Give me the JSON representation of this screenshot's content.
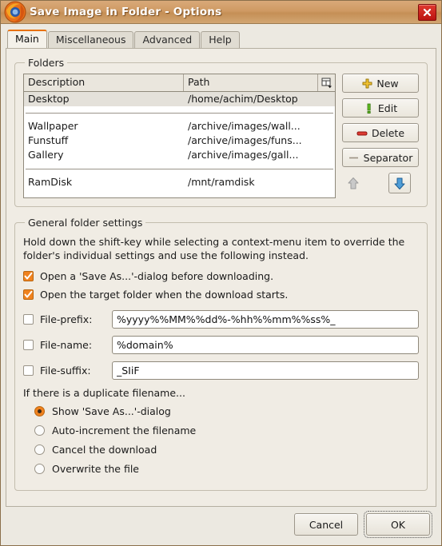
{
  "window": {
    "title": "Save Image in Folder - Options",
    "app_icon": "firefox-icon",
    "close_label": "×"
  },
  "tabs": [
    {
      "label": "Main",
      "active": true
    },
    {
      "label": "Miscellaneous",
      "active": false
    },
    {
      "label": "Advanced",
      "active": false
    },
    {
      "label": "Help",
      "active": false
    }
  ],
  "folders": {
    "legend": "Folders",
    "columns": [
      "Description",
      "Path"
    ],
    "column_picker_icon": "column-chooser-icon",
    "rows": [
      {
        "description": "Desktop",
        "path": "/home/achim/Desktop",
        "selected": true,
        "type": "item"
      },
      {
        "type": "separator"
      },
      {
        "description": "Wallpaper",
        "path": "/archive/images/wall...",
        "selected": false,
        "type": "item"
      },
      {
        "description": "Funstuff",
        "path": "/archive/images/funs...",
        "selected": false,
        "type": "item"
      },
      {
        "description": "Gallery",
        "path": "/archive/images/gall...",
        "selected": false,
        "type": "item"
      },
      {
        "type": "separator"
      },
      {
        "description": "RamDisk",
        "path": "/mnt/ramdisk",
        "selected": false,
        "type": "item"
      }
    ],
    "buttons": [
      {
        "label": "New",
        "icon": "plus-icon",
        "color": "#f0c419"
      },
      {
        "label": "Edit",
        "icon": "pencil-icon",
        "color": "#55aa22"
      },
      {
        "label": "Delete",
        "icon": "minus-icon",
        "color": "#d03030"
      },
      {
        "label": "Separator",
        "icon": "dash-icon",
        "color": "#9b9183"
      }
    ],
    "move_up": {
      "icon": "arrow-up-icon",
      "enabled": false
    },
    "move_down": {
      "icon": "arrow-down-icon",
      "enabled": true
    }
  },
  "general": {
    "legend": "General folder settings",
    "hint": "Hold down the shift-key while selecting a context-menu item to override the folder's individual settings and use the following instead.",
    "checkboxes": [
      {
        "label": "Open a 'Save As...'-dialog before downloading.",
        "checked": true
      },
      {
        "label": "Open the target folder when the download starts.",
        "checked": true
      }
    ],
    "fields": [
      {
        "label": "File-prefix:",
        "value": "%yyyy%%MM%%dd%-%hh%%mm%%ss%_",
        "checked": false
      },
      {
        "label": "File-name:",
        "value": "%domain%",
        "checked": false
      },
      {
        "label": "File-suffix:",
        "value": "_SIiF",
        "checked": false
      }
    ],
    "duplicate_title": "If there is a duplicate filename...",
    "duplicate_options": [
      {
        "label": "Show 'Save As...'-dialog",
        "selected": true
      },
      {
        "label": "Auto-increment the filename",
        "selected": false
      },
      {
        "label": "Cancel the download",
        "selected": false
      },
      {
        "label": "Overwrite the file",
        "selected": false
      }
    ]
  },
  "footer": {
    "cancel_label": "Cancel",
    "ok_label": "OK"
  }
}
